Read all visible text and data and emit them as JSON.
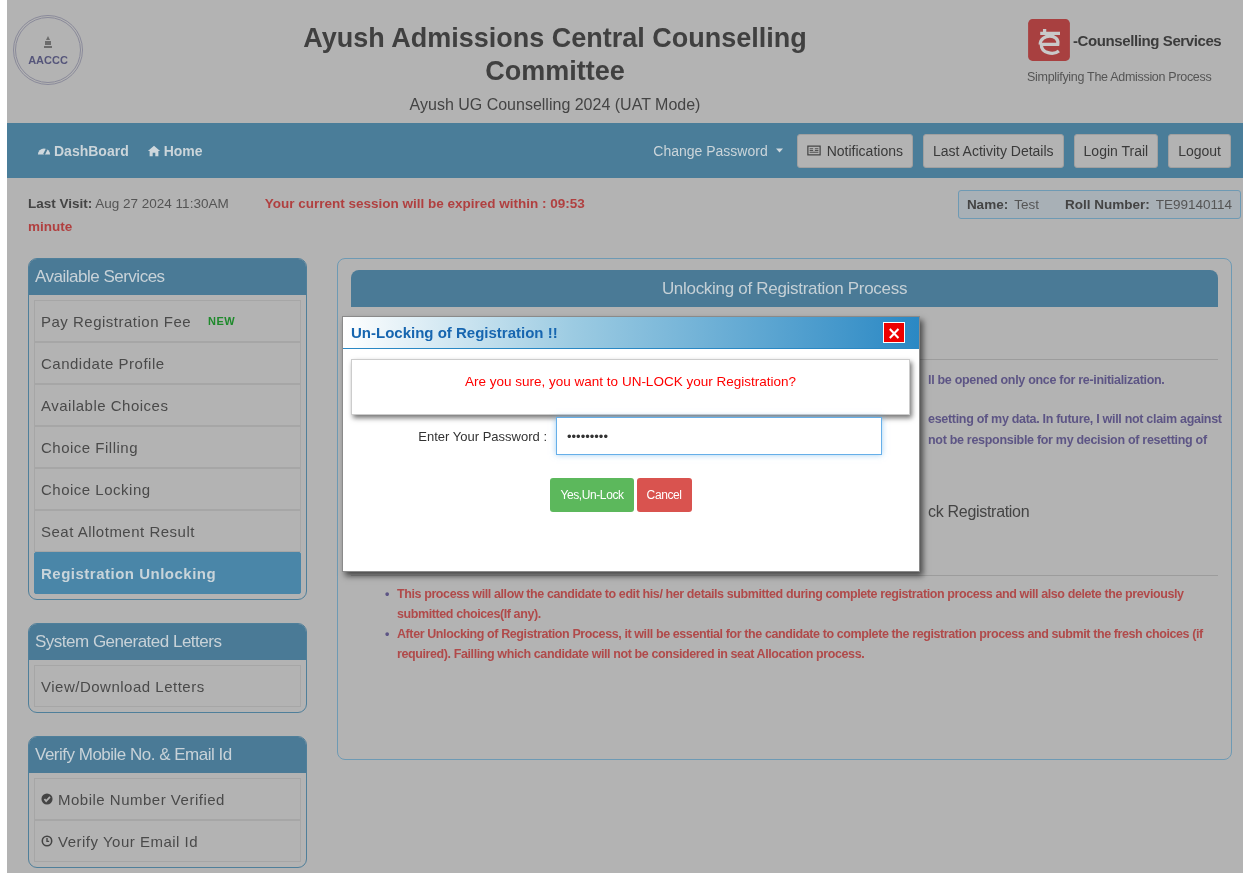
{
  "header": {
    "title": "Ayush Admissions Central Counselling Committee",
    "subtitle": "Ayush UG Counselling 2024 (UAT Mode)",
    "logo_text": "AACCC",
    "brand_name": "-Counselling Services",
    "brand_tagline": "Simplifying The Admission Process"
  },
  "nav": {
    "links": [
      {
        "label": "DashBoard",
        "kind": "dashboard"
      },
      {
        "label": "Home",
        "kind": "home"
      }
    ],
    "dropdown": "Change Password",
    "buttons": [
      {
        "label": "Notifications",
        "kind": "notifications"
      },
      {
        "label": "Last Activity Details",
        "kind": "plain"
      },
      {
        "label": "Login Trail",
        "kind": "plain"
      },
      {
        "label": "Logout",
        "kind": "plain"
      }
    ]
  },
  "info": {
    "last_visit_label": "Last Visit:",
    "last_visit_value": "Aug 27 2024 11:30AM",
    "session_text": "Your current session will be expired within : 09:53",
    "session_unit": "minute",
    "name_label": "Name:",
    "name_value": "Test",
    "roll_label": "Roll Number:",
    "roll_value": "TE99140114"
  },
  "sidebar": [
    {
      "title": "Available Services",
      "items": [
        {
          "label": "Pay Registration Fee",
          "badge": "NEW",
          "kind": "plain",
          "selected": false
        },
        {
          "label": "Candidate Profile",
          "kind": "plain",
          "selected": false
        },
        {
          "label": "Available Choices",
          "kind": "plain",
          "selected": false
        },
        {
          "label": "Choice Filling",
          "kind": "plain",
          "selected": false
        },
        {
          "label": "Choice Locking",
          "kind": "plain",
          "selected": false
        },
        {
          "label": "Seat Allotment Result",
          "kind": "plain",
          "selected": false
        },
        {
          "label": "Registration Unlocking",
          "kind": "plain",
          "selected": true
        }
      ]
    },
    {
      "title": "System Generated Letters",
      "items": [
        {
          "label": "View/Download Letters",
          "kind": "plain",
          "selected": false
        }
      ]
    },
    {
      "title": "Verify Mobile No. & Email Id",
      "items": [
        {
          "label": "Mobile Number Verified",
          "kind": "verified",
          "selected": false
        },
        {
          "label": "Verify Your Email Id",
          "kind": "pending",
          "selected": false
        }
      ]
    }
  ],
  "panel": {
    "title": "Unlocking of Registration Process",
    "visible_fragments": [
      "ll be opened only once for re-initialization.",
      "esetting of my data. In future, I will not claim against",
      "not be responsible for my decision of resetting of"
    ],
    "visible_heading": "ck Registration",
    "bullet": "•",
    "notes": [
      "This process will allow the candidate to edit his/ her details submitted during complete registration process and will also delete the previously submitted choices(If any).",
      "After Unlocking of Registration Process, it will be essential for the candidate to complete the registration process and submit the fresh choices (if required). Failling which candidate will not be considered in seat Allocation process."
    ]
  },
  "modal": {
    "title": "Un-Locking of Registration !!",
    "close": "×",
    "message": "Are you sure, you want to UN-LOCK your Registration?",
    "password_label": "Enter Your Password :",
    "password_value": "•••••••••",
    "buttons": [
      {
        "label": "Yes,Un-Lock",
        "kind": "confirm"
      },
      {
        "label": "Cancel",
        "kind": "cancel"
      }
    ]
  }
}
